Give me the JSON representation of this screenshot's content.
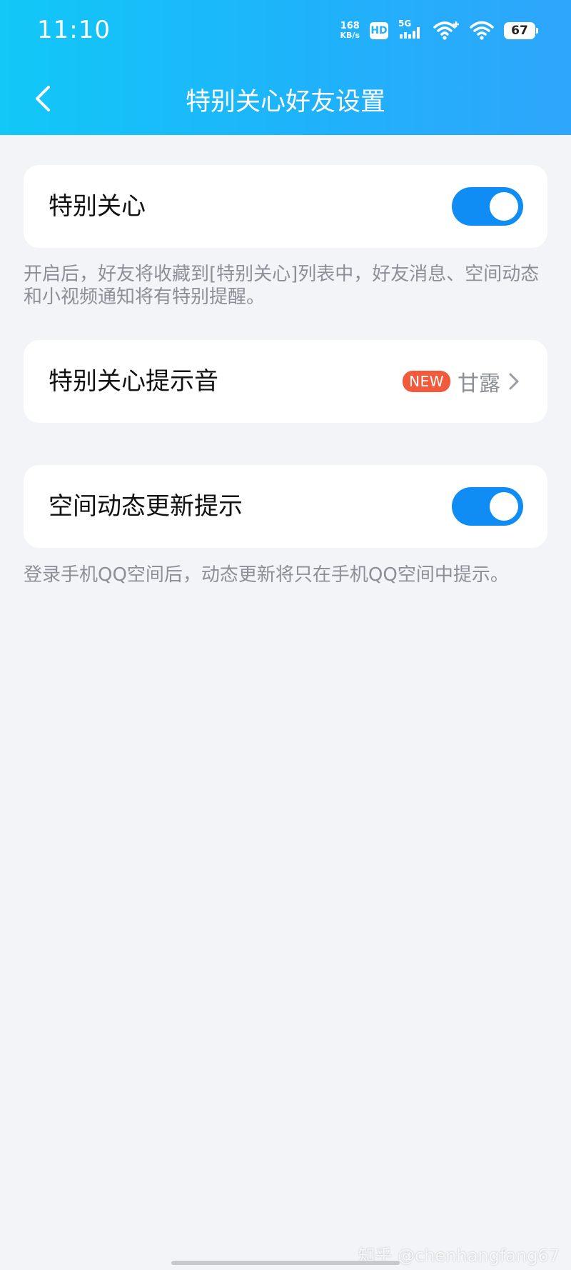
{
  "status_bar": {
    "time": "11:10",
    "net_speed_value": "168",
    "net_speed_unit": "KB/s",
    "hd_label": "HD",
    "signal_label": "5G",
    "battery": "67"
  },
  "nav": {
    "title": "特别关心好友设置"
  },
  "settings": {
    "special_care": {
      "label": "特别关心",
      "enabled": true,
      "hint": "开启后，好友将收藏到[特别关心]列表中，好友消息、空间动态和小视频通知将有特别提醒。"
    },
    "tone": {
      "label": "特别关心提示音",
      "badge": "NEW",
      "value": "甘露"
    },
    "qzone_updates": {
      "label": "空间动态更新提示",
      "enabled": true,
      "hint": "登录手机QQ空间后，动态更新将只在手机QQ空间中提示。"
    }
  },
  "colors": {
    "header_gradient_start": "#11c8f7",
    "header_gradient_end": "#2ea6fb",
    "toggle_on": "#0f8df5",
    "badge_new": "#f25a3b",
    "background": "#f3f4f8"
  },
  "watermark": "知乎 @chenhangfang67"
}
